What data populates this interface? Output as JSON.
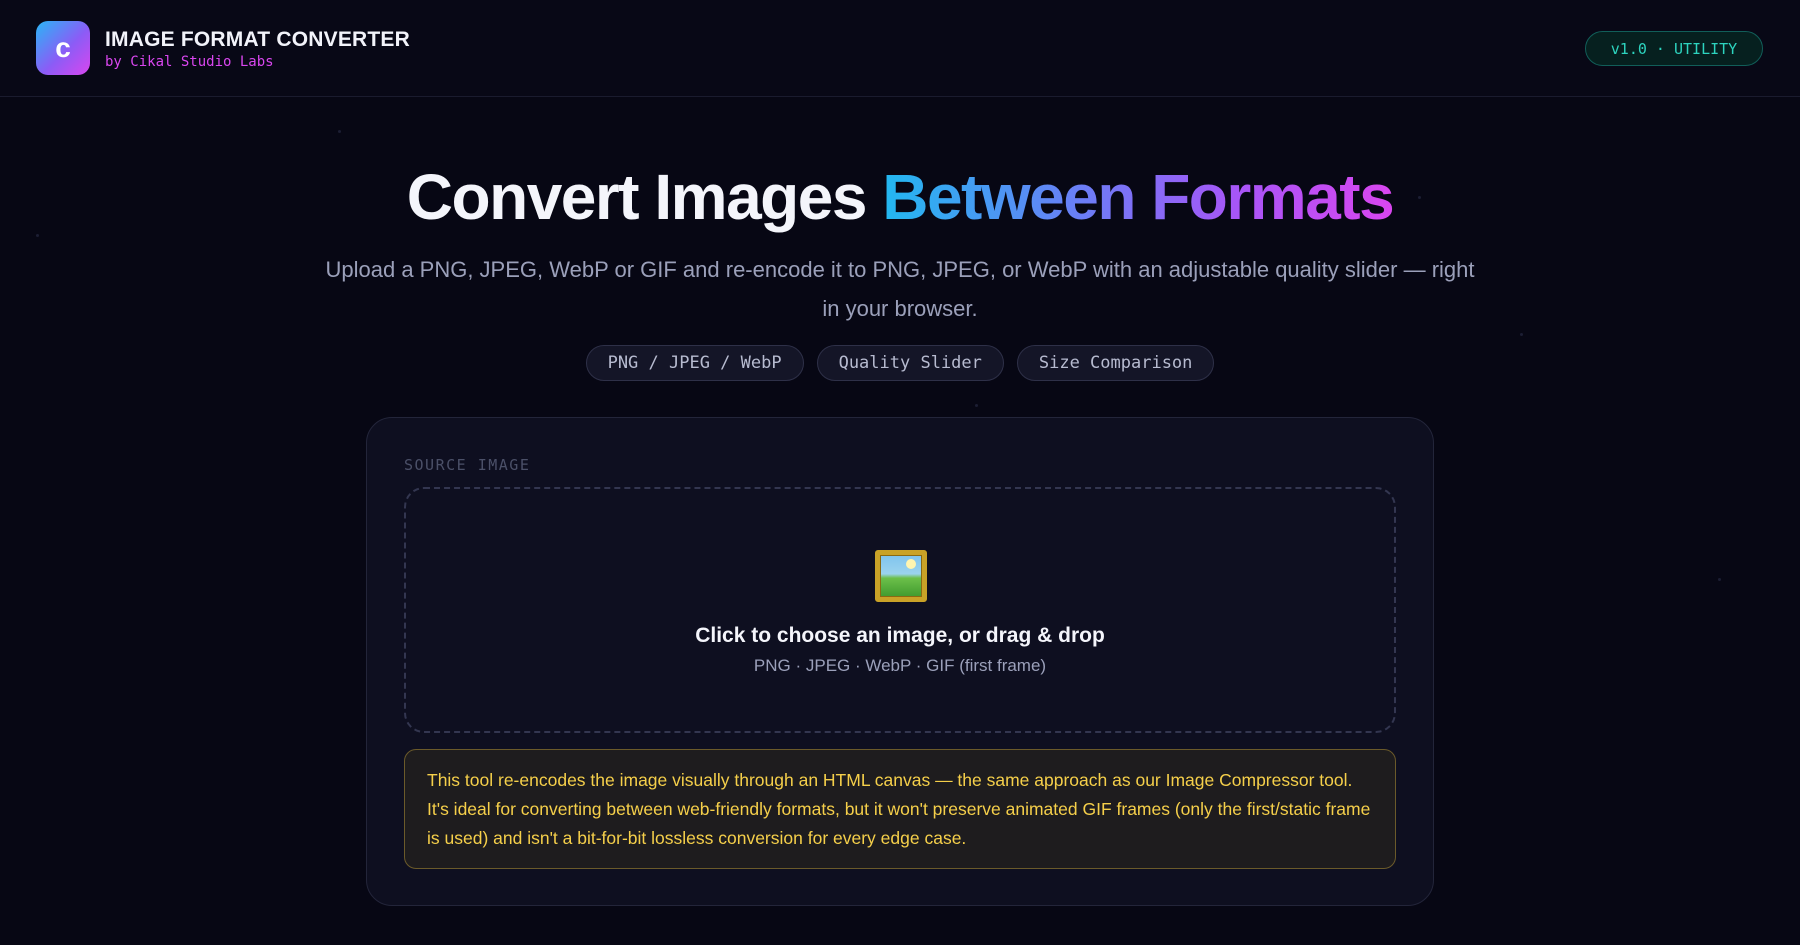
{
  "header": {
    "logo_letter": "c",
    "title": "IMAGE FORMAT CONVERTER",
    "subtitle": "by Cikal Studio Labs",
    "version_badge": "v1.0 · UTILITY"
  },
  "hero": {
    "title_plain": "Convert Images ",
    "title_gradient_1": "Between",
    "title_gradient_2": " Formats",
    "subtitle": "Upload a PNG, JPEG, WebP or GIF and re-encode it to PNG, JPEG, or WebP with an adjustable quality slider — right in your browser.",
    "chips": [
      "PNG / JPEG / WebP",
      "Quality Slider",
      "Size Comparison"
    ]
  },
  "card": {
    "label": "SOURCE IMAGE",
    "dropzone": {
      "icon": "framed-picture-icon",
      "title": "Click to choose an image, or drag & drop",
      "subtitle": "PNG · JPEG · WebP · GIF (first frame)"
    },
    "notice": "This tool re-encodes the image visually through an HTML canvas — the same approach as our Image Compressor tool. It's ideal for converting between web-friendly formats, but it won't preserve animated GIF frames (only the first/static frame is used) and isn't a bit-for-bit lossless conversion for every edge case."
  },
  "colors": {
    "background": "#070714",
    "accent_teal": "#2dd4bf",
    "accent_magenta": "#d946ef",
    "accent_blue": "#22b8f0",
    "notice_text": "#f5cf4a"
  }
}
